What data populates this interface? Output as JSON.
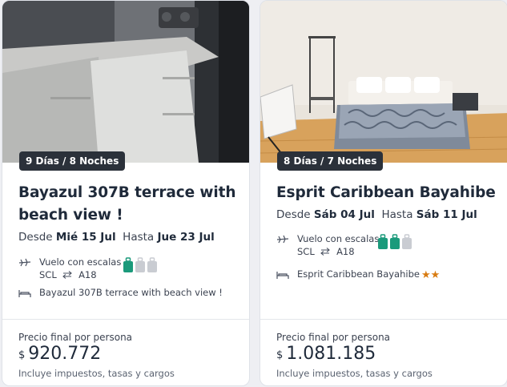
{
  "cards": [
    {
      "badge": "9 Días / 8 Noches",
      "title": "Bayazul 307B terrace with beach view !",
      "from_label": "Desde",
      "from_date": "Mié 15 Jul",
      "to_label": "Hasta",
      "to_date": "Jue 23 Jul",
      "flight_label": "Vuelo con escalas",
      "origin": "SCL",
      "destination": "A18",
      "hotel_name": "Bayazul 307B terrace with beach view !",
      "stars": "",
      "price_label": "Precio final por persona",
      "currency": "$",
      "price": "920.772",
      "taxes_label": "Incluye impuestos, tasas y cargos"
    },
    {
      "badge": "8 Días / 7 Noches",
      "title": "Esprit Caribbean Bayahibe",
      "from_label": "Desde",
      "from_date": "Sáb 04 Jul",
      "to_label": "Hasta",
      "to_date": "Sáb 11 Jul",
      "flight_label": "Vuelo con escalas",
      "origin": "SCL",
      "destination": "A18",
      "hotel_name": "Esprit Caribbean Bayahibe",
      "stars": "★★",
      "price_label": "Precio final por persona",
      "currency": "$",
      "price": "1.081.185",
      "taxes_label": "Incluye impuestos, tasas y cargos"
    }
  ],
  "colors": {
    "luggage_included": "#1b9a7b",
    "luggage_excluded": "#c9ccd2",
    "star": "#d87b10",
    "badge_bg": "#2b313a"
  },
  "icons": {
    "flight": "airplane-icon",
    "route": "round-trip-arrows-icon",
    "hotel": "bed-icon",
    "bag": "luggage-icon"
  }
}
